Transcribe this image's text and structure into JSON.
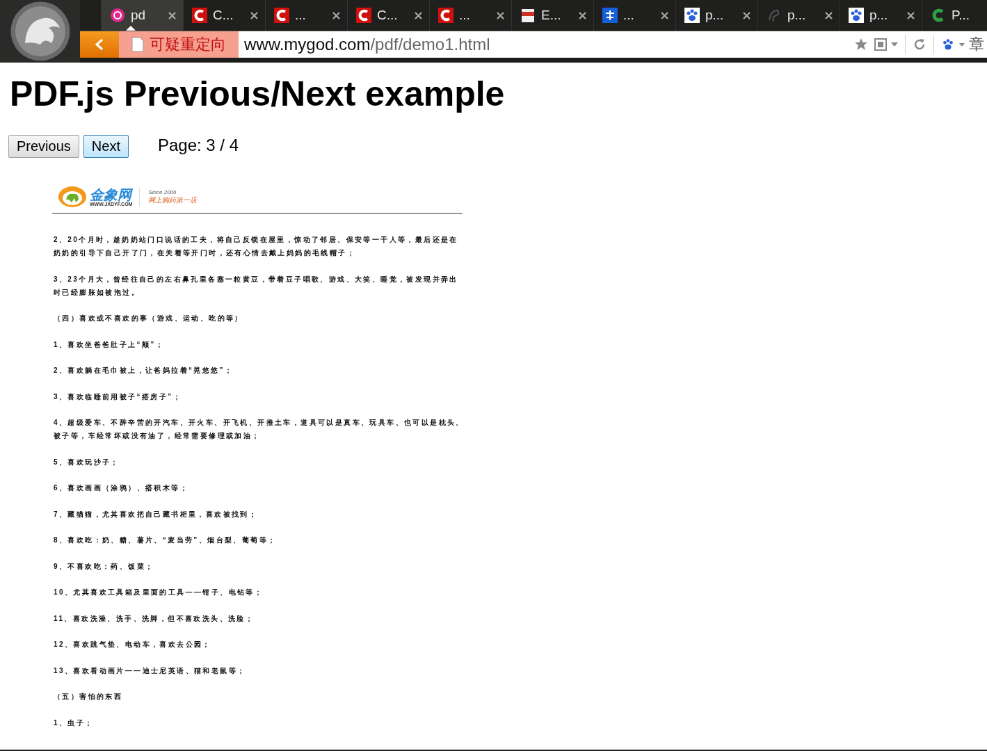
{
  "browser": {
    "tabs": [
      {
        "kind": "pink",
        "title": "pd",
        "selected": true,
        "closable": true
      },
      {
        "kind": "redc",
        "title": "C...",
        "selected": false,
        "closable": true
      },
      {
        "kind": "redc",
        "title": "...",
        "selected": false,
        "closable": true
      },
      {
        "kind": "redc",
        "title": "C...",
        "selected": false,
        "closable": true
      },
      {
        "kind": "redc",
        "title": "...",
        "selected": false,
        "closable": true
      },
      {
        "kind": "doc",
        "title": "E...",
        "selected": false,
        "closable": true
      },
      {
        "kind": "blue",
        "title": "...",
        "selected": false,
        "closable": true
      },
      {
        "kind": "paw",
        "title": "p...",
        "selected": false,
        "closable": true
      },
      {
        "kind": "swirl",
        "title": "p...",
        "selected": false,
        "closable": true
      },
      {
        "kind": "paw",
        "title": "p...",
        "selected": false,
        "closable": true
      },
      {
        "kind": "greenc",
        "title": "P...",
        "selected": false,
        "closable": false
      }
    ],
    "warning": "可疑重定向",
    "url_host": "www.mygod.com",
    "url_path": "/pdf/demo1.html",
    "search_text": "章"
  },
  "page": {
    "title": "PDF.js Previous/Next example",
    "buttons": [
      {
        "label": "Previous",
        "focused": false
      },
      {
        "label": "Next",
        "focused": true
      }
    ],
    "page_label": "Page: 3 / 4",
    "pdf": {
      "logo_name": "金象网",
      "logo_url": "WWW.JXDYF.COM",
      "logo_since": "Since 2006",
      "logo_slogan": "网上购药第一店",
      "paragraphs": [
        [
          "2、20个月时，趁奶奶站门口说话的工夫，将自己反锁在屋里，惊动了邻居、保安等一干人等，最后还是在",
          "奶奶的引导下自己开了门，在关着等开门时，还有心情去戴上妈妈的毛线帽子；"
        ],
        [
          "3、23个月大，曾经往自己的左右鼻孔里各塞一粒黄豆，带着豆子唱歌、游戏、大笑、睡觉，被发现并弄出",
          "时已经膨胀如被泡过。"
        ],
        [
          "（四）喜欢或不喜欢的事（游戏、运动、吃的等）"
        ],
        [
          "1、喜欢坐爸爸肚子上“颠”；"
        ],
        [
          "2、喜欢躺在毛巾被上，让爸妈拉着“晃悠悠”；"
        ],
        [
          "3、喜欢临睡前用被子“搭房子”；"
        ],
        [
          "4、超级爱车、不辞辛苦的开汽车、开火车、开飞机、开推土车，道具可以是真车、玩具车、也可以是枕头、",
          "被子等，车经常坏或没有油了，经常需要修理或加油；"
        ],
        [
          "5、喜欢玩沙子；"
        ],
        [
          "6、喜欢画画（涂鸦）、搭积木等；"
        ],
        [
          "7、藏猫猫，尤其喜欢把自己藏书柜里，喜欢被找到；"
        ],
        [
          "8、喜欢吃：奶、糖、薯片、“麦当劳”、烟台梨、葡萄等；"
        ],
        [
          "9、不喜欢吃：药、饭菜；"
        ],
        [
          "10、尤其喜欢工具箱及里面的工具——钳子、电钻等；"
        ],
        [
          "11、喜欢洗澡、洗手、洗脚，但不喜欢洗头、洗脸；"
        ],
        [
          "12、喜欢跳气垫、电动车，喜欢去公园；"
        ],
        [
          "13、喜欢看动画片——迪士尼英语、猫和老鼠等；"
        ],
        [
          "（五）害怕的东西"
        ],
        [
          "1、虫子；"
        ]
      ]
    }
  }
}
